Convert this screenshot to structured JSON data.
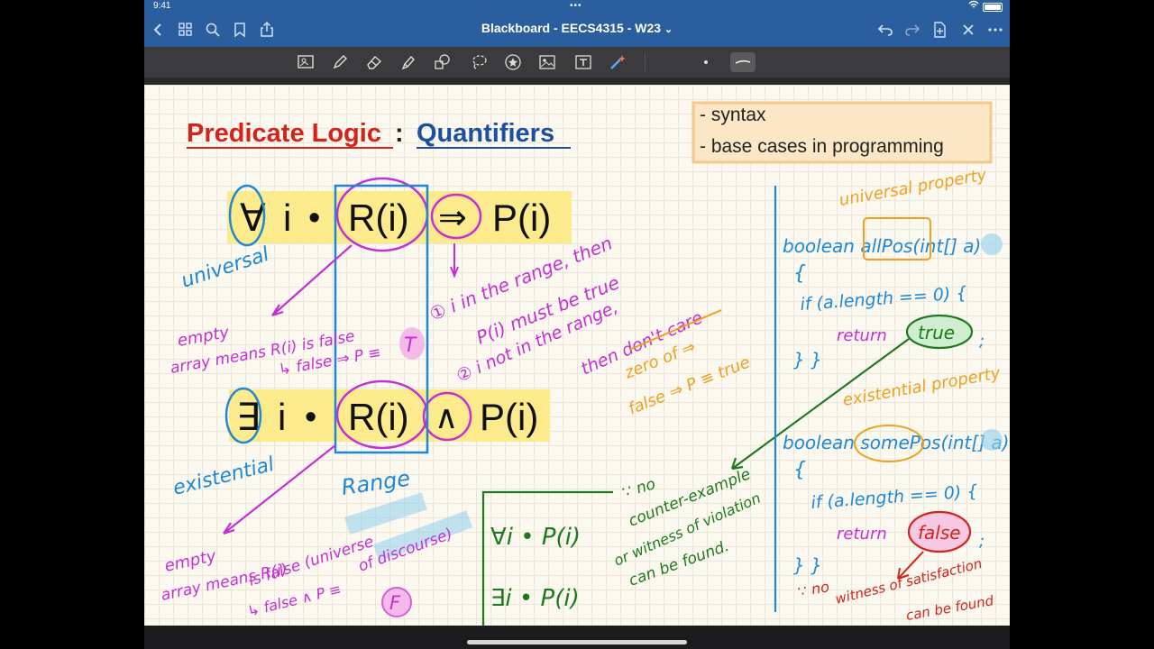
{
  "status_bar": {
    "time": "9:41",
    "dots": "•••",
    "battery": "100%"
  },
  "nav": {
    "title": "Blackboard - EECS4315 - W23",
    "title_chevron": "⌄"
  },
  "page": {
    "title_red": "Predicate Logic",
    "title_colon": ":",
    "title_blue": "Quantifiers",
    "notes_box": [
      "- syntax",
      "- base cases in programming"
    ],
    "formula_universal": {
      "quantifier": "∀",
      "var": "i",
      "dot": "•",
      "range": "R(i)",
      "op": "⇒",
      "body": "P(i)"
    },
    "formula_existential": {
      "quantifier": "∃",
      "var": "i",
      "dot": "•",
      "range": "R(i)",
      "op": "∧",
      "body": "P(i)"
    },
    "labels": {
      "universal": "universal",
      "existential": "existential",
      "range": "Range"
    },
    "annotations": {
      "empty_universal_1": "empty",
      "empty_universal_2": "array means R(i) is false",
      "empty_universal_3": "↳ false ⇒ P ≡",
      "truth_T": "T",
      "note_1_a": "① i in the range, then",
      "note_1_b": "P(i) must be true",
      "note_2_a": "② i not in the range,",
      "note_2_b": "then don't care",
      "zero_of": "zero of ⇒",
      "false_imp": "false ⇒ P ≡ true",
      "empty_exist_1": "empty",
      "empty_exist_2": "array means R(i)",
      "empty_exist_3": "is false (universe",
      "empty_exist_4": "↳ false ∧ P ≡",
      "of_discourse": "of discourse)",
      "truth_F": "F",
      "box_forall": "∀i • P(i)",
      "box_exists": "∃i • P(i)",
      "green_note_1": "∵ no",
      "green_note_2": "counter-example",
      "green_note_3": "or witness of violation",
      "green_note_4": "can be found.",
      "universal_property": "universal property",
      "boolean_allPos": "boolean allPos(int[] a)",
      "brace_open_1": "{",
      "if_len_1": "if (a.length == 0) {",
      "return_1": "return",
      "true_val": "true",
      "semi_1": ";",
      "brace_close_1": "} }",
      "existential_property": "existential property",
      "boolean_somePos": "boolean somePos(int[] a)",
      "brace_open_2": "{",
      "if_len_2": "if (a.length == 0) {",
      "return_2": "return",
      "false_val": "false",
      "semi_2": ";",
      "brace_close_2": "} }",
      "red_note_1": "∵ no",
      "red_note_2": "witness of satisfaction",
      "red_note_3": "can be found"
    }
  },
  "colors": {
    "nav_bg": "#2b5e9e",
    "toolbar_bg": "#3b3b3d",
    "paper": "#fbf8ef",
    "red": "#d3231b",
    "blue": "#1c4fa0",
    "magenta": "#c52fd3",
    "cyan": "#1e88d6",
    "orange": "#f0a020",
    "green": "#1f7a1f",
    "highlight_yellow": "#fbeb8c"
  },
  "icons": {
    "nav": [
      "back-icon",
      "grid-icon",
      "search-icon",
      "bookmark-icon",
      "share-icon",
      "undo-icon",
      "redo-icon",
      "add-page-icon",
      "close-icon",
      "more-icon"
    ],
    "tools": [
      "image-select-icon",
      "pen-icon",
      "eraser-icon",
      "highlighter-icon",
      "shapes-icon",
      "lasso-icon",
      "star-icon",
      "image-icon",
      "text-icon",
      "laser-icon",
      "dot-size-icon",
      "stroke-icon"
    ]
  }
}
